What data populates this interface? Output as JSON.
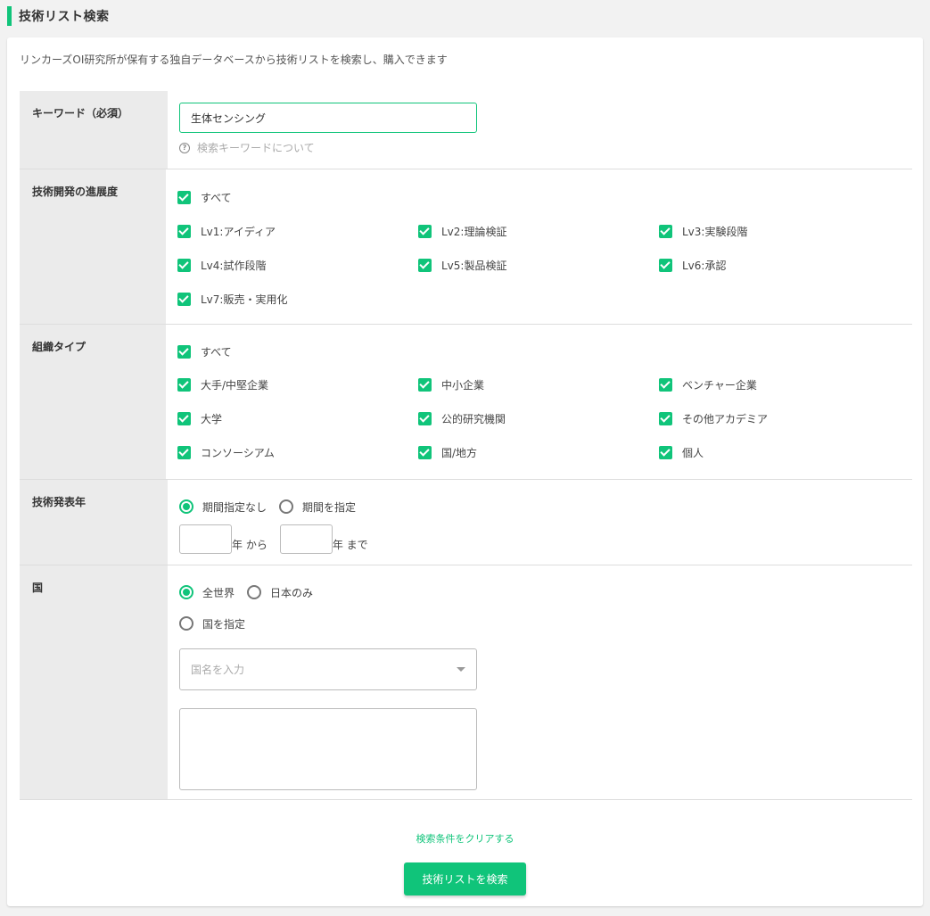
{
  "page": {
    "title": "技術リスト検索"
  },
  "description": "リンカーズOI研究所が保有する独自データベースから技術リストを検索し、購入できます",
  "keyword": {
    "label": "キーワード（必須）",
    "value": "生体センシング",
    "help_text": "検索キーワードについて",
    "help_icon": "question-circle-icon"
  },
  "progress": {
    "label": "技術開発の進展度",
    "all_label": "すべて",
    "options": [
      [
        "Lv1:アイディア",
        "Lv2:理論検証",
        "Lv3:実験段階"
      ],
      [
        "Lv4:試作段階",
        "Lv5:製品検証",
        "Lv6:承認"
      ],
      [
        "Lv7:販売・実用化"
      ]
    ]
  },
  "org_type": {
    "label": "組織タイプ",
    "all_label": "すべて",
    "options": [
      [
        "大手/中堅企業",
        "中小企業",
        "ベンチャー企業"
      ],
      [
        "大学",
        "公的研究機関",
        "その他アカデミア"
      ],
      [
        "コンソーシアム",
        "国/地方",
        "個人"
      ]
    ]
  },
  "year": {
    "label": "技術発表年",
    "radio_none": "期間指定なし",
    "radio_range": "期間を指定",
    "from_suffix": "年 から",
    "to_suffix": "年 まで",
    "from_value": "",
    "to_value": ""
  },
  "country": {
    "label": "国",
    "radio_world": "全世界",
    "radio_japan": "日本のみ",
    "radio_specify": "国を指定",
    "select_placeholder": "国名を入力"
  },
  "actions": {
    "clear_label": "検索条件をクリアする",
    "search_label": "技術リストを検索"
  },
  "colors": {
    "accent": "#10c47a"
  }
}
